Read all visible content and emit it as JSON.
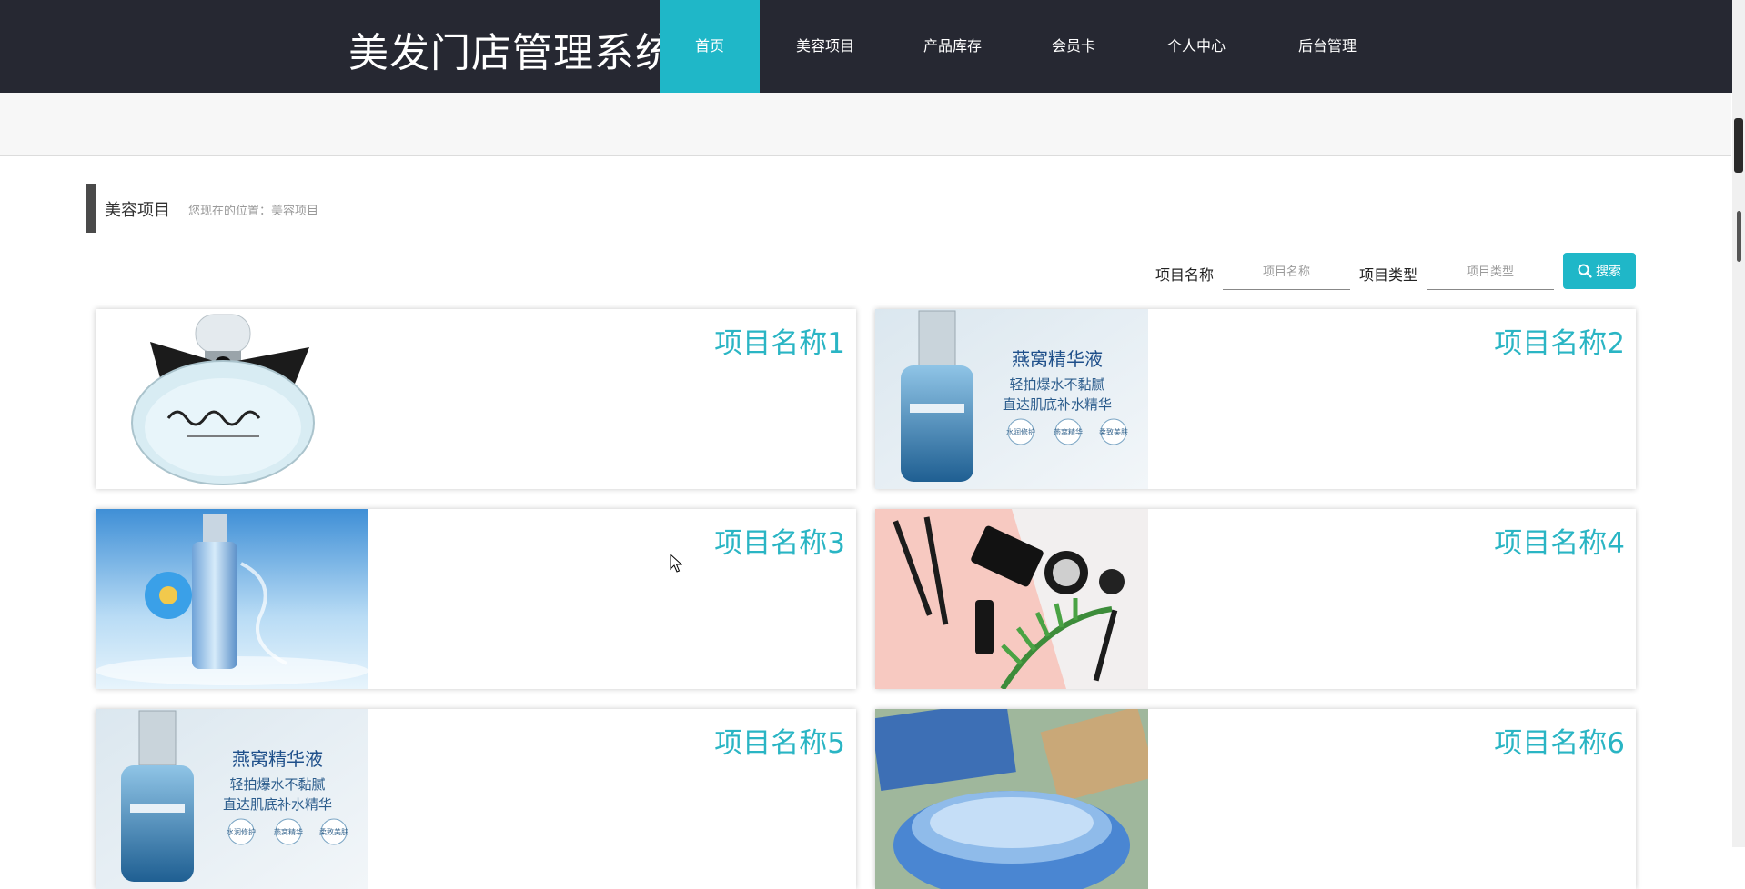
{
  "site": {
    "title": "美发门店管理系统"
  },
  "nav": {
    "items": [
      {
        "label": "首页",
        "active": true
      },
      {
        "label": "美容项目"
      },
      {
        "label": "产品库存"
      },
      {
        "label": "会员卡"
      },
      {
        "label": "个人中心"
      },
      {
        "label": "后台管理"
      }
    ]
  },
  "section": {
    "title": "美容项目",
    "breadcrumb": "您现在的位置：美容项目"
  },
  "search": {
    "name_label": "项目名称",
    "name_placeholder": "项目名称",
    "type_label": "项目类型",
    "type_placeholder": "项目类型",
    "button_label": "搜索",
    "button_icon": "search-icon"
  },
  "cards": [
    {
      "title": "项目名称1",
      "image": "perfume-bottle-image"
    },
    {
      "title": "项目名称2",
      "image": "essence-serum-ad-image",
      "ad_text": [
        "燕窝精华液",
        "轻拍爆水不黏腻",
        "直达肌底补水精华"
      ],
      "badges": [
        "水润修护",
        "燕窝精华",
        "柔致美肤"
      ]
    },
    {
      "title": "项目名称3",
      "image": "blue-serum-splash-image"
    },
    {
      "title": "项目名称4",
      "image": "makeup-brushes-image"
    },
    {
      "title": "项目名称5",
      "image": "essence-serum-ad-image",
      "ad_text": [
        "燕窝精华液",
        "轻拍爆水不黏腻",
        "直达肌底补水精华"
      ],
      "badges": [
        "水润修护",
        "燕窝精华",
        "柔致美肤"
      ]
    },
    {
      "title": "项目名称6",
      "image": "sleeping-mask-jar-image"
    }
  ],
  "colors": {
    "nav_bg": "#262832",
    "accent": "#1fb7c8",
    "card_title": "#2ab5c4"
  }
}
